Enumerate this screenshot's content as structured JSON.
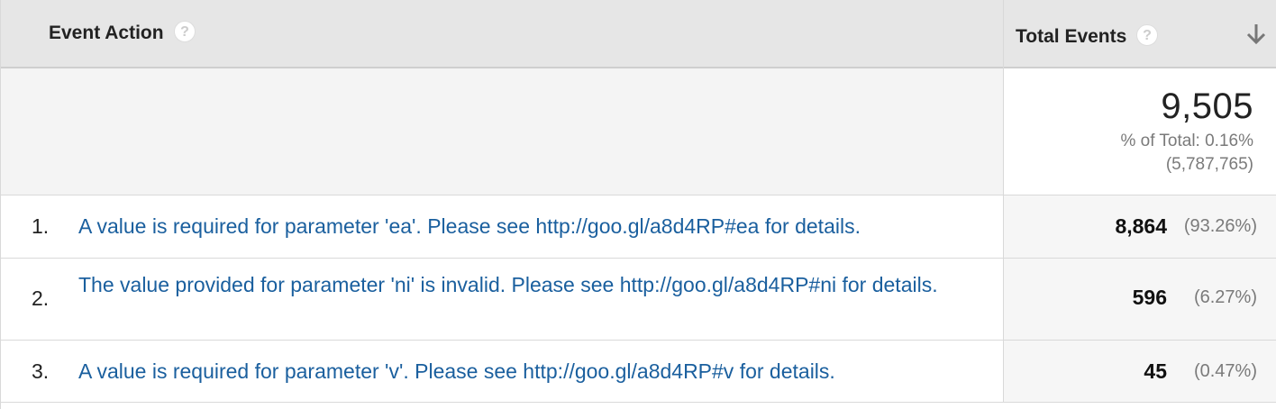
{
  "header": {
    "event_action_label": "Event Action",
    "total_events_label": "Total Events",
    "help_glyph": "?"
  },
  "totals": {
    "value": "9,505",
    "percent_of_total": "% of Total: 0.16%",
    "absolute_total": "(5,787,765)"
  },
  "rows": [
    {
      "index": "1.",
      "action": "A value is required for parameter 'ea'. Please see http://goo.gl/a8d4RP#ea for details.",
      "total_events": "8,864",
      "percent": "(93.26%)"
    },
    {
      "index": "2.",
      "action": "The value provided for parameter 'ni' is invalid. Please see http://goo.gl/a8d4RP#ni for details.",
      "total_events": "596",
      "percent": "(6.27%)"
    },
    {
      "index": "3.",
      "action": "A value is required for parameter 'v'. Please see http://goo.gl/a8d4RP#v for details.",
      "total_events": "45",
      "percent": "(0.47%)"
    }
  ],
  "colors": {
    "link": "#1a5f9e",
    "header_bg": "#e6e6e6",
    "totals_bg": "#f4f4f4",
    "metric_cell_bg": "#f6f6f6"
  },
  "icons": {
    "help": "help-icon",
    "sort": "sort-descending-icon"
  }
}
